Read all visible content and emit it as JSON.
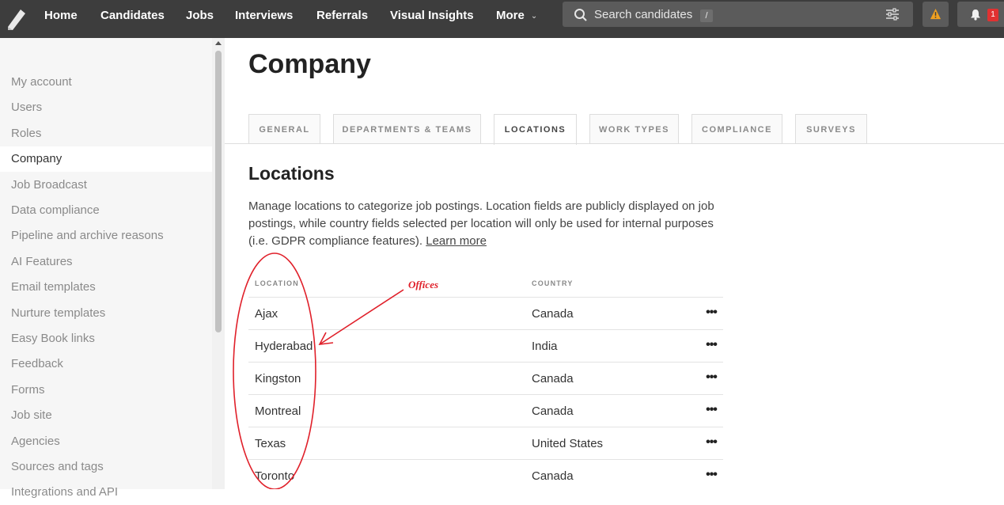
{
  "nav": {
    "items": [
      "Home",
      "Candidates",
      "Jobs",
      "Interviews",
      "Referrals",
      "Visual Insights",
      "More"
    ],
    "search_placeholder": "Search candidates",
    "search_shortcut": "/",
    "notification_count": "1",
    "icons": [
      "logo-icon",
      "search-icon",
      "filter-icon",
      "warning-icon",
      "bell-icon",
      "chevron-down-icon"
    ]
  },
  "sidebar": {
    "items": [
      {
        "label": "My account"
      },
      {
        "label": "Users"
      },
      {
        "label": "Roles"
      },
      {
        "label": "Company",
        "active": true
      },
      {
        "label": "Job Broadcast"
      },
      {
        "label": "Data compliance"
      },
      {
        "label": "Pipeline and archive reasons"
      },
      {
        "label": "AI Features"
      },
      {
        "label": "Email templates"
      },
      {
        "label": "Nurture templates"
      },
      {
        "label": "Easy Book links"
      },
      {
        "label": "Feedback"
      },
      {
        "label": "Forms"
      },
      {
        "label": "Job site"
      },
      {
        "label": "Agencies"
      },
      {
        "label": "Sources and tags"
      },
      {
        "label": "Integrations and API"
      }
    ]
  },
  "main": {
    "title": "Company",
    "tabs": [
      "GENERAL",
      "DEPARTMENTS & TEAMS",
      "LOCATIONS",
      "WORK TYPES",
      "COMPLIANCE",
      "SURVEYS"
    ],
    "active_tab": "LOCATIONS",
    "section_title": "Locations",
    "description": "Manage locations to categorize job postings. Location fields are publicly displayed on job postings, while country fields selected per location will only be used for internal purposes (i.e. GDPR compliance features).",
    "learn_more": "Learn more",
    "table": {
      "headers": [
        "LOCATION",
        "COUNTRY"
      ],
      "rows": [
        {
          "location": "Ajax",
          "country": "Canada"
        },
        {
          "location": "Hyderabad",
          "country": "India"
        },
        {
          "location": "Kingston",
          "country": "Canada"
        },
        {
          "location": "Montreal",
          "country": "Canada"
        },
        {
          "location": "Texas",
          "country": "United States"
        },
        {
          "location": "Toronto",
          "country": "Canada"
        }
      ],
      "row_action": "•••"
    }
  },
  "annotation": {
    "label": "Offices",
    "color": "#e0202a"
  },
  "colors": {
    "topbar": "#3d3d3d",
    "search_bg": "#5b5b5b",
    "warning": "#f0a020",
    "badge": "#e03131"
  }
}
